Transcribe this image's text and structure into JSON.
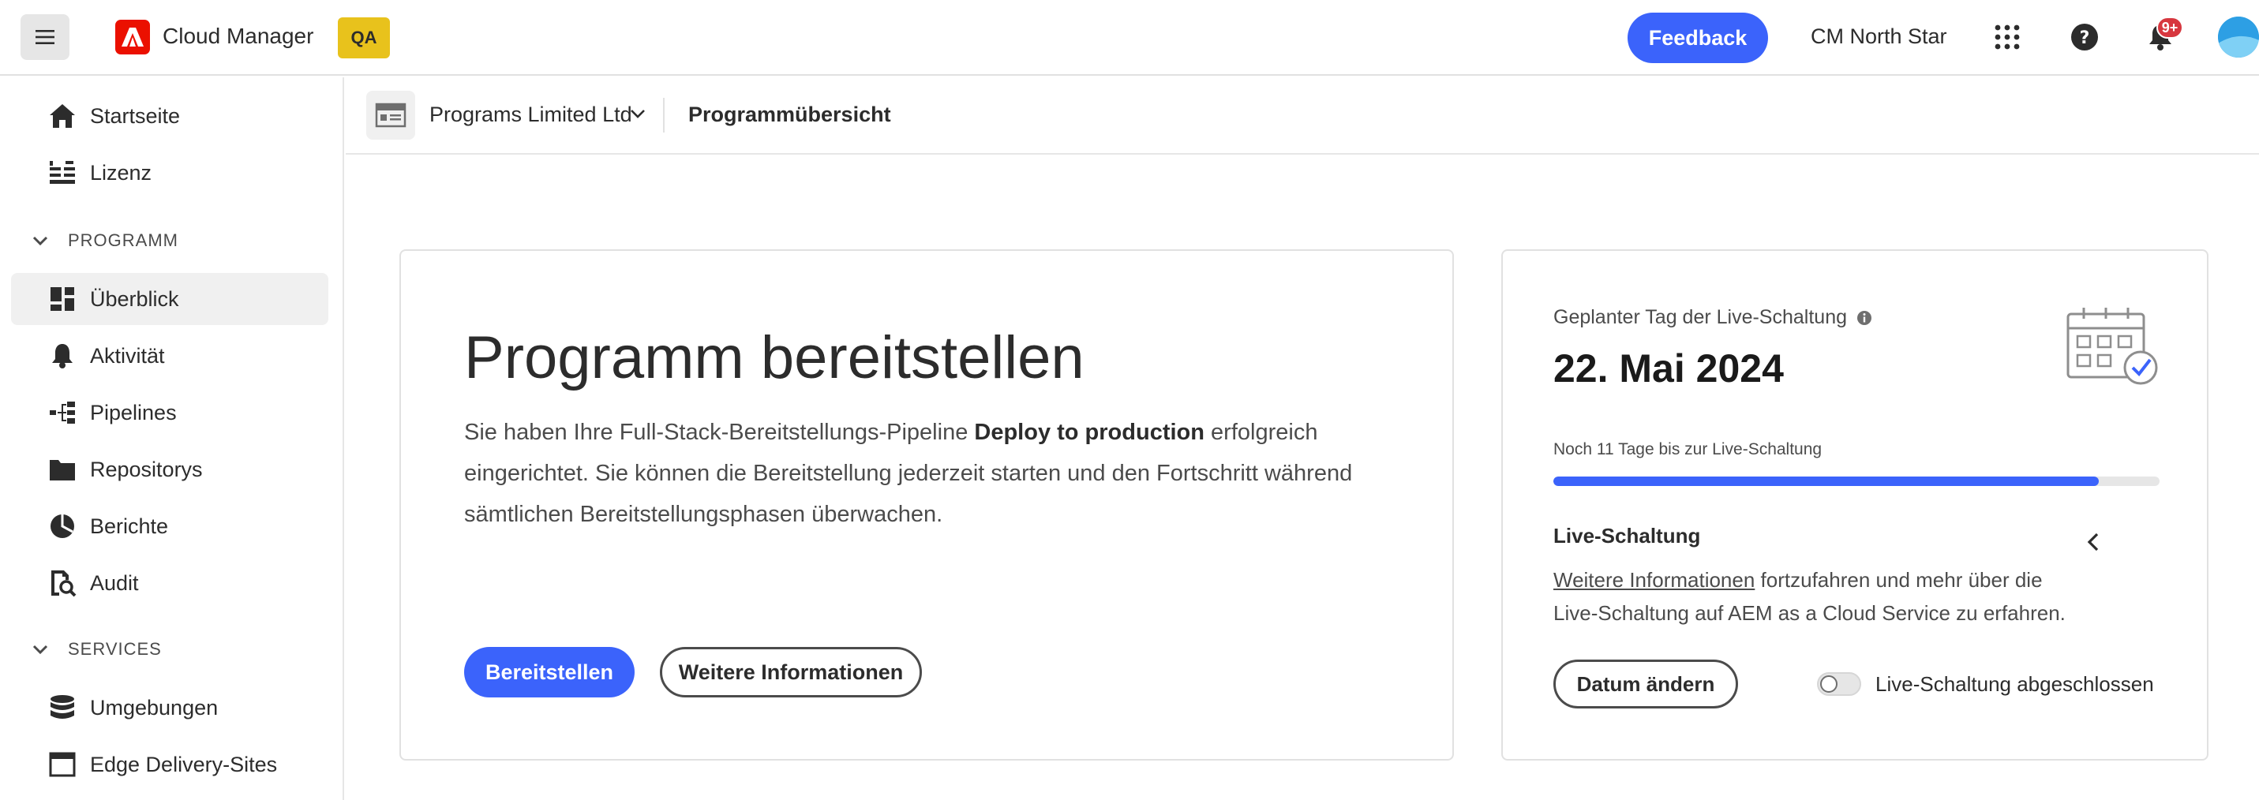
{
  "header": {
    "app_title": "Cloud Manager",
    "env_badge": "QA",
    "feedback_label": "Feedback",
    "org_name": "CM North Star",
    "notification_count": "9+",
    "icons": [
      "menu-icon",
      "adobe-logo",
      "apps-grid-icon",
      "help-icon",
      "bell-icon",
      "user-avatar"
    ],
    "accent_color": "#3b63fb",
    "badge_color": "#e8c21c"
  },
  "sidebar": {
    "top_items": [
      {
        "label": "Startseite",
        "icon": "home-icon"
      },
      {
        "label": "Lizenz",
        "icon": "license-icon"
      }
    ],
    "sections": [
      {
        "title": "PROGRAMM",
        "items": [
          {
            "label": "Überblick",
            "icon": "dashboard-icon",
            "active": true
          },
          {
            "label": "Aktivität",
            "icon": "bell-icon"
          },
          {
            "label": "Pipelines",
            "icon": "pipeline-icon"
          },
          {
            "label": "Repositorys",
            "icon": "folder-icon"
          },
          {
            "label": "Berichte",
            "icon": "pie-chart-icon"
          },
          {
            "label": "Audit",
            "icon": "audit-icon"
          }
        ]
      },
      {
        "title": "SERVICES",
        "items": [
          {
            "label": "Umgebungen",
            "icon": "database-icon"
          },
          {
            "label": "Edge Delivery-Sites",
            "icon": "window-icon"
          }
        ]
      }
    ]
  },
  "breadcrumb": {
    "program": "Programs Limited Ltd",
    "current": "Programmübersicht"
  },
  "deploy_card": {
    "title": "Programm bereitstellen",
    "text_before": "Sie haben Ihre Full-Stack-Bereitstellungs-Pipeline ",
    "pipeline_name": "Deploy to production",
    "text_after": " erfolgreich eingerichtet. Sie können die Bereitstellung jederzeit starten und den Fortschritt während sämtlichen Bereitstellungsphasen überwachen.",
    "primary_button": "Bereitstellen",
    "secondary_button": "Weitere Informationen"
  },
  "golive_card": {
    "label": "Geplanter Tag der Live-Schaltung",
    "date": "22. Mai 2024",
    "days_remaining": "Noch 11 Tage bis zur Live-Schaltung",
    "progress_percent": 90,
    "section_title": "Live-Schaltung",
    "link_text": "Weitere Informationen",
    "text_after_link": " fortzufahren und mehr über die Live-Schaltung auf AEM as a Cloud Service zu erfahren.",
    "change_date_button": "Datum ändern",
    "toggle_label": "Live-Schaltung abgeschlossen",
    "toggle_on": false
  }
}
